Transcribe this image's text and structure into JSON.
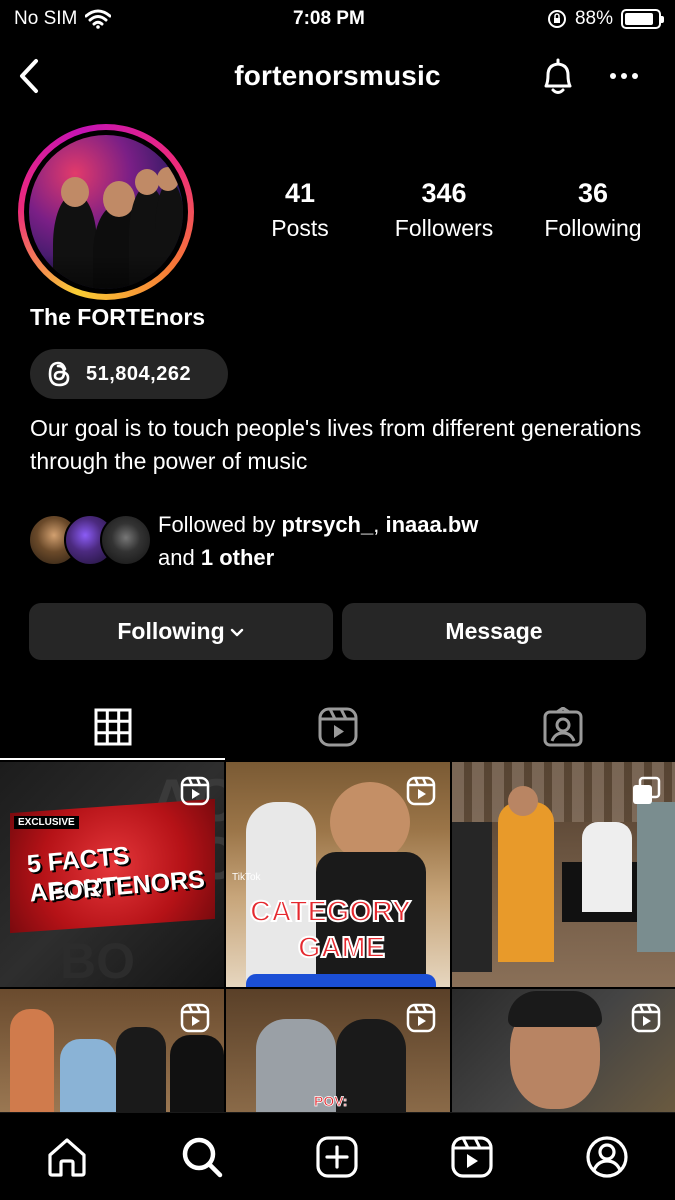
{
  "status_bar": {
    "carrier": "No SIM",
    "time": "7:08 PM",
    "battery_pct": "88%",
    "battery_level": 0.88
  },
  "nav": {
    "username": "fortenorsmusic"
  },
  "profile": {
    "display_name": "The FORTEnors",
    "threads_count": "51,804,262",
    "bio": "Our goal is to touch people's lives from different generations through the power of music"
  },
  "stats": [
    {
      "value": "41",
      "label": "Posts"
    },
    {
      "value": "346",
      "label": "Followers"
    },
    {
      "value": "36",
      "label": "Following"
    }
  ],
  "followed_by": {
    "prefix": "Followed by",
    "user1": "ptrsych_",
    "separator": ", ",
    "user2": "inaaa.bw",
    "middle": "and",
    "rest": "1 other"
  },
  "buttons": {
    "following": "Following",
    "message": "Message"
  },
  "tabs": [
    {
      "icon": "grid-icon",
      "selected": true
    },
    {
      "icon": "reels-icon",
      "selected": false
    },
    {
      "icon": "tagged-icon",
      "selected": false
    }
  ],
  "grid_posts": [
    {
      "type": "reel",
      "badge_label": "EXCLUSIVE",
      "title_line1": "5 FACTS ABOUT",
      "title_line2": "FORTENORS"
    },
    {
      "type": "reel",
      "title_line1": "CATEGORY",
      "title_line2": "GAME",
      "watermark": "TikTok"
    },
    {
      "type": "carousel"
    },
    {
      "type": "reel"
    },
    {
      "type": "reel",
      "caption": "POV:"
    },
    {
      "type": "reel"
    }
  ],
  "bottom_nav": [
    "home-icon",
    "search-icon",
    "create-icon",
    "reels-icon",
    "profile-icon"
  ],
  "colors": {
    "background": "#000000",
    "button_bg": "#262626",
    "threads_red": "#e8333c"
  }
}
